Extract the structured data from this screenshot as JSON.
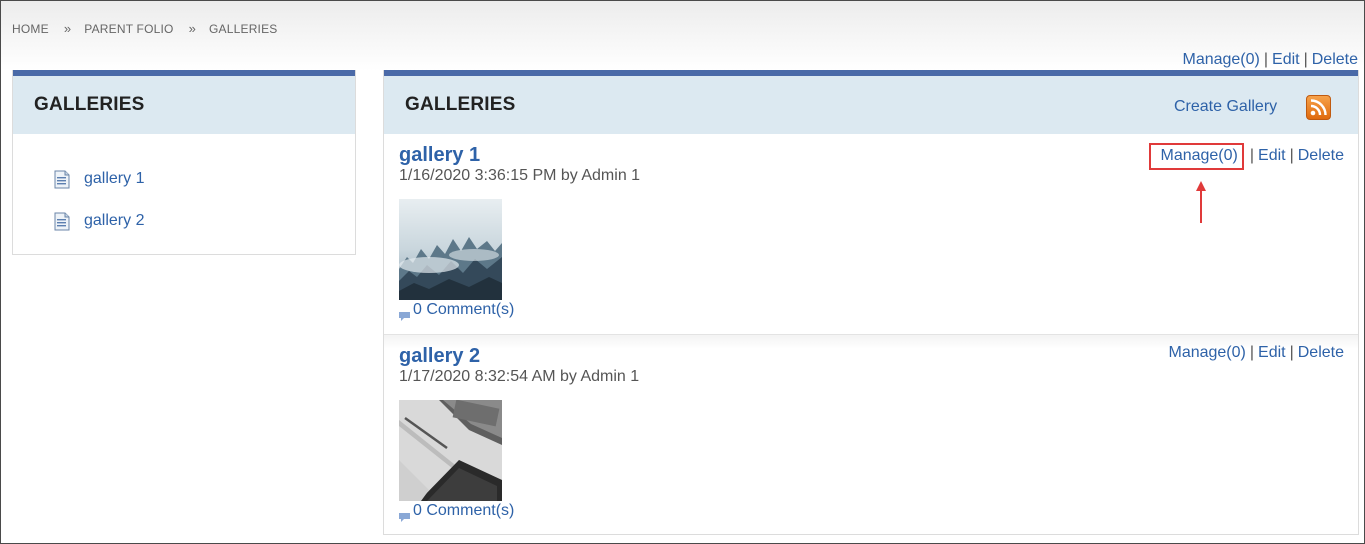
{
  "breadcrumb": {
    "items": [
      "HOME",
      "PARENT FOLIO",
      "GALLERIES"
    ],
    "separator": "»"
  },
  "top_actions": {
    "manage": "Manage(0)",
    "edit": "Edit",
    "delete": "Delete",
    "pipe": "|"
  },
  "left_panel": {
    "title": "GALLERIES",
    "items": [
      {
        "label": "gallery 1",
        "icon": "document-icon"
      },
      {
        "label": "gallery 2",
        "icon": "document-icon"
      }
    ]
  },
  "right_panel": {
    "title": "GALLERIES",
    "create_label": "Create Gallery",
    "rss_icon": "rss-icon",
    "entries": [
      {
        "title": "gallery 1",
        "meta": "1/16/2020 3:36:15 PM by Admin 1",
        "manage": "Manage(0)",
        "edit": "Edit",
        "delete": "Delete",
        "comments": "0 Comment(s)",
        "thumbnail": "misty forest photo"
      },
      {
        "title": "gallery 2",
        "meta": "1/17/2020 8:32:54 AM by Admin 1",
        "manage": "Manage(0)",
        "edit": "Edit",
        "delete": "Delete",
        "comments": "0 Comment(s)",
        "thumbnail": "desk laptop photo"
      }
    ]
  },
  "colors": {
    "link": "#2e62a8",
    "header_bg": "#dce9f1",
    "header_border": "#4a6aa8",
    "highlight": "#e03a3a"
  }
}
